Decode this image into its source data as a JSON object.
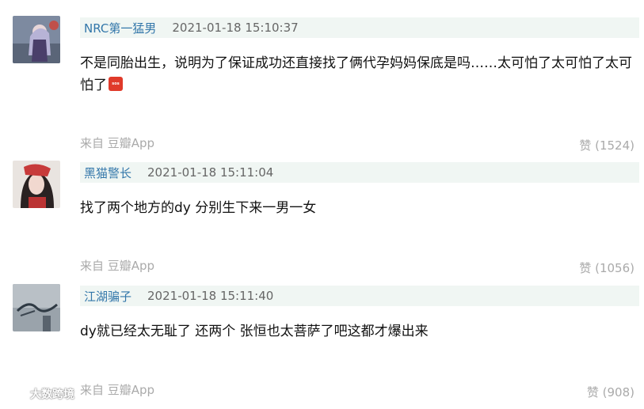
{
  "comments": [
    {
      "username": "NRC第一猛男",
      "timestamp": "2021-01-18 15:10:37",
      "content": "不是同胎出生，说明为了保证成功还直接找了俩代孕妈妈保底是吗……太可怕了太可怕了太可怕了",
      "emoji": "sos",
      "source": "来自 豆瓣App",
      "likes": "赞 (1524)"
    },
    {
      "username": "黑猫警长",
      "timestamp": "2021-01-18 15:11:04",
      "content": "找了两个地方的dy 分别生下来一男一女",
      "source": "来自 豆瓣App",
      "likes": "赞 (1056)"
    },
    {
      "username": "江湖骗子",
      "timestamp": "2021-01-18 15:11:40",
      "content": "dy就已经太无耻了 还两个 张恒也太菩萨了吧这都才爆出来",
      "source": "来自 豆瓣App",
      "likes": "赞 (908)"
    }
  ],
  "watermark": "大数跨境"
}
